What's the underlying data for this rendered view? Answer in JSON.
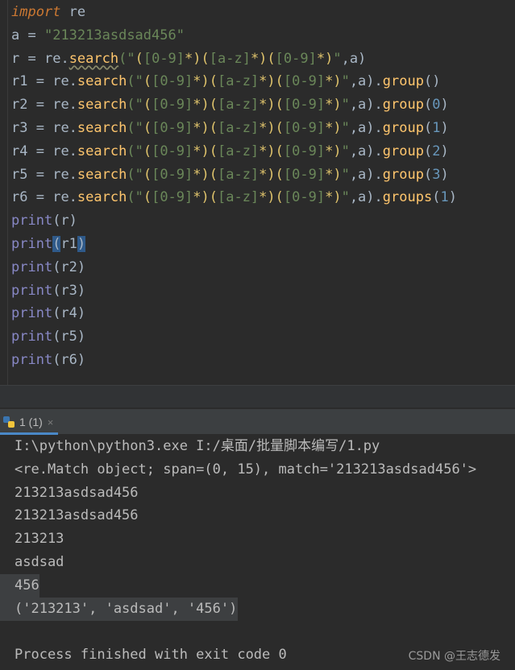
{
  "editor": {
    "lines": [
      [
        {
          "t": "import",
          "c": "kw-italic"
        },
        {
          "t": " re",
          "c": "id"
        }
      ],
      [
        {
          "t": "a",
          "c": "id"
        },
        {
          "t": " = ",
          "c": "op"
        },
        {
          "t": "\"213213asdsad456\"",
          "c": "str"
        }
      ],
      [
        {
          "t": "r",
          "c": "id"
        },
        {
          "t": " = ",
          "c": "op"
        },
        {
          "t": "re.",
          "c": "id"
        },
        {
          "t": "search",
          "c": "fn squiggle"
        },
        {
          "t": "(\"",
          "c": "str"
        },
        {
          "t": "(",
          "c": "rx-group"
        },
        {
          "t": "[0-9]",
          "c": "rx-class"
        },
        {
          "t": "*)(",
          "c": "rx-group"
        },
        {
          "t": "[a-z]",
          "c": "rx-class"
        },
        {
          "t": "*)(",
          "c": "rx-group"
        },
        {
          "t": "[0-9]",
          "c": "rx-class"
        },
        {
          "t": "*)",
          "c": "rx-group"
        },
        {
          "t": "\"",
          "c": "str"
        },
        {
          "t": ",a)",
          "c": "op"
        }
      ],
      [
        {
          "t": "r1",
          "c": "id"
        },
        {
          "t": " = ",
          "c": "op"
        },
        {
          "t": "re.",
          "c": "id"
        },
        {
          "t": "search",
          "c": "fn"
        },
        {
          "t": "(\"",
          "c": "str"
        },
        {
          "t": "(",
          "c": "rx-group"
        },
        {
          "t": "[0-9]",
          "c": "rx-class"
        },
        {
          "t": "*)(",
          "c": "rx-group"
        },
        {
          "t": "[a-z]",
          "c": "rx-class"
        },
        {
          "t": "*)(",
          "c": "rx-group"
        },
        {
          "t": "[0-9]",
          "c": "rx-class"
        },
        {
          "t": "*)",
          "c": "rx-group"
        },
        {
          "t": "\"",
          "c": "str"
        },
        {
          "t": ",a).",
          "c": "op"
        },
        {
          "t": "group",
          "c": "fn"
        },
        {
          "t": "()",
          "c": "op"
        }
      ],
      [
        {
          "t": "r2",
          "c": "id"
        },
        {
          "t": " = ",
          "c": "op"
        },
        {
          "t": "re.",
          "c": "id"
        },
        {
          "t": "search",
          "c": "fn"
        },
        {
          "t": "(\"",
          "c": "str"
        },
        {
          "t": "(",
          "c": "rx-group"
        },
        {
          "t": "[0-9]",
          "c": "rx-class"
        },
        {
          "t": "*)(",
          "c": "rx-group"
        },
        {
          "t": "[a-z]",
          "c": "rx-class"
        },
        {
          "t": "*)(",
          "c": "rx-group"
        },
        {
          "t": "[0-9]",
          "c": "rx-class"
        },
        {
          "t": "*)",
          "c": "rx-group"
        },
        {
          "t": "\"",
          "c": "str"
        },
        {
          "t": ",a).",
          "c": "op"
        },
        {
          "t": "group",
          "c": "fn"
        },
        {
          "t": "(",
          "c": "op"
        },
        {
          "t": "0",
          "c": "num"
        },
        {
          "t": ")",
          "c": "op"
        }
      ],
      [
        {
          "t": "r3",
          "c": "id"
        },
        {
          "t": " = ",
          "c": "op"
        },
        {
          "t": "re.",
          "c": "id"
        },
        {
          "t": "search",
          "c": "fn"
        },
        {
          "t": "(\"",
          "c": "str"
        },
        {
          "t": "(",
          "c": "rx-group"
        },
        {
          "t": "[0-9]",
          "c": "rx-class"
        },
        {
          "t": "*)(",
          "c": "rx-group"
        },
        {
          "t": "[a-z]",
          "c": "rx-class"
        },
        {
          "t": "*)(",
          "c": "rx-group"
        },
        {
          "t": "[0-9]",
          "c": "rx-class"
        },
        {
          "t": "*)",
          "c": "rx-group"
        },
        {
          "t": "\"",
          "c": "str"
        },
        {
          "t": ",a).",
          "c": "op"
        },
        {
          "t": "group",
          "c": "fn"
        },
        {
          "t": "(",
          "c": "op"
        },
        {
          "t": "1",
          "c": "num"
        },
        {
          "t": ")",
          "c": "op"
        }
      ],
      [
        {
          "t": "r4",
          "c": "id"
        },
        {
          "t": " = ",
          "c": "op"
        },
        {
          "t": "re.",
          "c": "id"
        },
        {
          "t": "search",
          "c": "fn"
        },
        {
          "t": "(\"",
          "c": "str"
        },
        {
          "t": "(",
          "c": "rx-group"
        },
        {
          "t": "[0-9]",
          "c": "rx-class"
        },
        {
          "t": "*)(",
          "c": "rx-group"
        },
        {
          "t": "[a-z]",
          "c": "rx-class"
        },
        {
          "t": "*)(",
          "c": "rx-group"
        },
        {
          "t": "[0-9]",
          "c": "rx-class"
        },
        {
          "t": "*)",
          "c": "rx-group"
        },
        {
          "t": "\"",
          "c": "str"
        },
        {
          "t": ",a).",
          "c": "op"
        },
        {
          "t": "group",
          "c": "fn"
        },
        {
          "t": "(",
          "c": "op"
        },
        {
          "t": "2",
          "c": "num"
        },
        {
          "t": ")",
          "c": "op"
        }
      ],
      [
        {
          "t": "r5",
          "c": "id"
        },
        {
          "t": " = ",
          "c": "op"
        },
        {
          "t": "re.",
          "c": "id"
        },
        {
          "t": "search",
          "c": "fn"
        },
        {
          "t": "(\"",
          "c": "str"
        },
        {
          "t": "(",
          "c": "rx-group"
        },
        {
          "t": "[0-9]",
          "c": "rx-class"
        },
        {
          "t": "*)(",
          "c": "rx-group"
        },
        {
          "t": "[a-z]",
          "c": "rx-class"
        },
        {
          "t": "*)(",
          "c": "rx-group"
        },
        {
          "t": "[0-9]",
          "c": "rx-class"
        },
        {
          "t": "*)",
          "c": "rx-group"
        },
        {
          "t": "\"",
          "c": "str"
        },
        {
          "t": ",a).",
          "c": "op"
        },
        {
          "t": "group",
          "c": "fn"
        },
        {
          "t": "(",
          "c": "op"
        },
        {
          "t": "3",
          "c": "num"
        },
        {
          "t": ")",
          "c": "op"
        }
      ],
      [
        {
          "t": "r6",
          "c": "id"
        },
        {
          "t": " = ",
          "c": "op"
        },
        {
          "t": "re.",
          "c": "id"
        },
        {
          "t": "search",
          "c": "fn"
        },
        {
          "t": "(\"",
          "c": "str"
        },
        {
          "t": "(",
          "c": "rx-group"
        },
        {
          "t": "[0-9]",
          "c": "rx-class"
        },
        {
          "t": "*)(",
          "c": "rx-group"
        },
        {
          "t": "[a-z]",
          "c": "rx-class"
        },
        {
          "t": "*)(",
          "c": "rx-group"
        },
        {
          "t": "[0-9]",
          "c": "rx-class"
        },
        {
          "t": "*)",
          "c": "rx-group"
        },
        {
          "t": "\"",
          "c": "str"
        },
        {
          "t": ",a).",
          "c": "op"
        },
        {
          "t": "groups",
          "c": "fn"
        },
        {
          "t": "(",
          "c": "op"
        },
        {
          "t": "1",
          "c": "num"
        },
        {
          "t": ")",
          "c": "op"
        }
      ],
      [
        {
          "t": "print",
          "c": "bi"
        },
        {
          "t": "(r)",
          "c": "op"
        }
      ],
      [
        {
          "t": "print",
          "c": "bi"
        },
        {
          "t": "(",
          "c": "op caret-hl"
        },
        {
          "t": "r1",
          "c": "id"
        },
        {
          "t": ")",
          "c": "op caret-hl"
        }
      ],
      [
        {
          "t": "print",
          "c": "bi"
        },
        {
          "t": "(r2)",
          "c": "op"
        }
      ],
      [
        {
          "t": "print",
          "c": "bi"
        },
        {
          "t": "(r3)",
          "c": "op"
        }
      ],
      [
        {
          "t": "print",
          "c": "bi"
        },
        {
          "t": "(r4)",
          "c": "op"
        }
      ],
      [
        {
          "t": "print",
          "c": "bi"
        },
        {
          "t": "(r5)",
          "c": "op"
        }
      ],
      [
        {
          "t": "print",
          "c": "bi"
        },
        {
          "t": "(r6)",
          "c": "op"
        }
      ]
    ]
  },
  "run_panel": {
    "tab_label": "1 (1)",
    "close_glyph": "×"
  },
  "console": {
    "lines": [
      "I:\\python\\python3.exe I:/桌面/批量脚本编写/1.py",
      "<re.Match object; span=(0, 15), match='213213asdsad456'>",
      "213213asdsad456",
      "213213asdsad456",
      "213213",
      "asdsad",
      "456",
      "('213213', 'asdsad', '456')",
      "",
      "Process finished with exit code 0"
    ],
    "highlighted": [
      6,
      7
    ]
  },
  "watermark": "CSDN @王志德发",
  "colors": {
    "editor_bg": "#2b2b2b",
    "keyword": "#cc7832",
    "function": "#ffc66d",
    "builtin": "#8888c6",
    "string": "#6a8759",
    "number": "#6897bb",
    "tab_accent": "#4a88c7"
  }
}
